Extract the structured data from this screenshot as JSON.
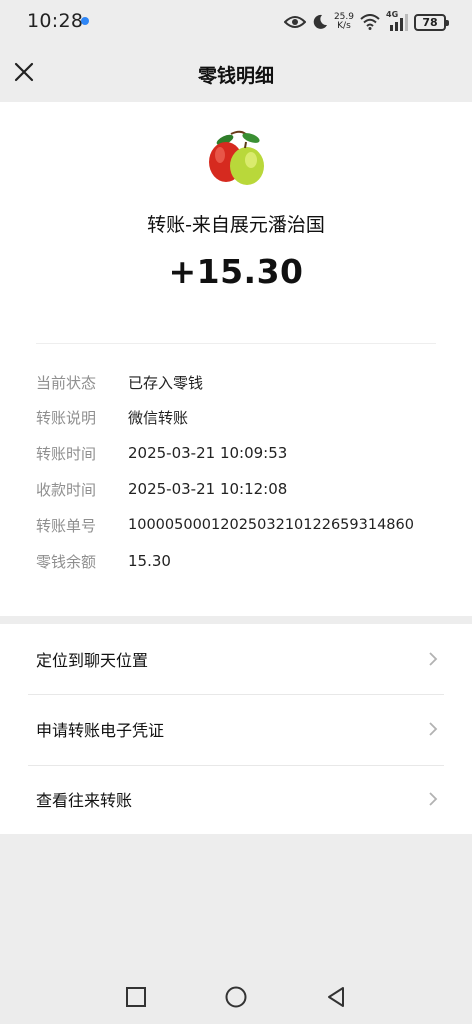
{
  "status_bar": {
    "time": "10:28",
    "speed_value": "25.9",
    "speed_unit": "K/s",
    "network": "4G",
    "battery": "78",
    "dot_color": "#2f86f6"
  },
  "nav": {
    "title": "零钱明细",
    "close_icon": "close-icon"
  },
  "transfer": {
    "avatar_icon": "apples-avatar",
    "title": "转账-来自展元潘治国",
    "amount": "+15.30"
  },
  "details": [
    {
      "label": "当前状态",
      "value": "已存入零钱"
    },
    {
      "label": "转账说明",
      "value": "微信转账"
    },
    {
      "label": "转账时间",
      "value": "2025-03-21 10:09:53"
    },
    {
      "label": "收款时间",
      "value": "2025-03-21 10:12:08"
    },
    {
      "label": "转账单号",
      "value": "1000050001202503210122659314860"
    },
    {
      "label": "零钱余额",
      "value": "15.30"
    }
  ],
  "actions": [
    {
      "label": "定位到聊天位置"
    },
    {
      "label": "申请转账电子凭证"
    },
    {
      "label": "查看往来转账"
    }
  ],
  "system_nav": {
    "recent_icon": "square-icon",
    "home_icon": "circle-icon",
    "back_icon": "triangle-back-icon"
  }
}
